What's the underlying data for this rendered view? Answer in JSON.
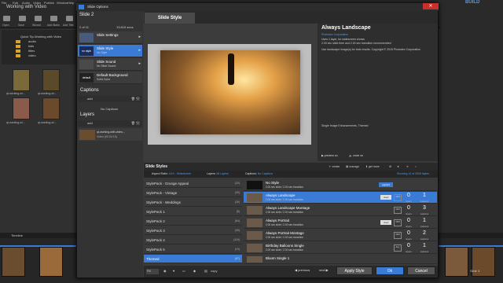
{
  "app": {
    "title": "Working with Video",
    "menu": [
      "File",
      "Edit",
      "Audio",
      "Video",
      "Publish",
      "Window",
      "Help"
    ],
    "toolbar": [
      "Open",
      "Save",
      "Wizard",
      "Add Blank",
      "Add Title"
    ],
    "build_label": "BUILD",
    "tree": [
      "Quick Tip-Working with Video",
      "audio",
      "kids",
      "titles",
      "video"
    ],
    "thumbs": [
      "qt-working-wi...",
      "qt-working-wi...",
      "qt-working-wi...",
      "qt-working-wi..."
    ],
    "timeline_tabs": [
      "Timeline"
    ],
    "slide3": {
      "title": "Slide 3",
      "sub": "Always Portrait"
    },
    "status": "1 Slide Selected"
  },
  "dialog": {
    "title": "Slide Options",
    "close": "✕",
    "slide": {
      "heading": "Slide 2",
      "nav": "2 of 11",
      "seconds": "13.815 secs"
    },
    "left_items": [
      {
        "icon": "",
        "title": "Slide Settings",
        "sub": "",
        "selected": false
      },
      {
        "icon": "no style",
        "title": "Slide Style",
        "sub": "No Style",
        "selected": true
      },
      {
        "icon": "",
        "title": "Slide Sound",
        "sub": "No Slide Sound",
        "selected": false
      },
      {
        "icon": "default",
        "title": "Default Background",
        "sub": "Solid Color",
        "selected": false
      }
    ],
    "captions": {
      "heading": "Captions",
      "add": "add",
      "empty": "No Captions"
    },
    "layers": {
      "heading": "Layers",
      "add": "add",
      "name": "qt-working-with-video...",
      "sub": "Video (00:00:15)"
    },
    "tab": "Slide Style",
    "info": {
      "title": "Always Landscape",
      "author": "Photodex Corporation",
      "line1": "Uses 1 layer, for widescreen shows",
      "line2": "2.00 sec slide time and 2.00 sec transition recommended",
      "line3": "Use landscape image(s) for best results. Copyright © 2015 Photodex Corporation",
      "tags": "Single Image Enhancements, Themed",
      "preview_on": "preview on",
      "mute_on": "mute on"
    },
    "styles": {
      "heading": "Slide Styles",
      "tools": [
        "create",
        "manage",
        "get more"
      ],
      "aspect_label": "Aspect Ratio:",
      "aspect_value": "16:9 - Widescreen",
      "layers_label": "Layers:",
      "layers_value": "All Layers",
      "captions_label": "Captions:",
      "captions_value": "No Captions",
      "showing": "Showing 12 of 2545 styles",
      "packs": [
        {
          "name": "StylePack - Grunge Appeal",
          "count": "(20)",
          "selected": false
        },
        {
          "name": "StylePack - Vintage",
          "count": "(30)",
          "selected": false
        },
        {
          "name": "StylePack - Weddings",
          "count": "(26)",
          "selected": false
        },
        {
          "name": "StylePack 1",
          "count": "(8)",
          "selected": false
        },
        {
          "name": "StylePack 2",
          "count": "(64)",
          "selected": false
        },
        {
          "name": "StylePack 3",
          "count": "(35)",
          "selected": false
        },
        {
          "name": "StylePack 4",
          "count": "(119)",
          "selected": false
        },
        {
          "name": "StylePack 5",
          "count": "(19)",
          "selected": false
        },
        {
          "name": "Themed",
          "count": "(97)",
          "selected": true
        }
      ],
      "rows": [
        {
          "name": "No Style",
          "sub": "2.00 sec slide / 2.00 sec transition",
          "badge": "applied",
          "ratio": "",
          "layers": "",
          "captions": "",
          "selected": false
        },
        {
          "name": "Always Landscape",
          "sub": "2.00 sec slide / 2.00 sec transition",
          "badge": "used",
          "ratio": "16:9",
          "layers": "0",
          "captions": "1",
          "selected": true
        },
        {
          "name": "Always Landscape Montage",
          "sub": "2.00 sec slide / 2.00 sec transition",
          "badge": "",
          "ratio": "16:9",
          "layers": "0",
          "captions": "3",
          "selected": false
        },
        {
          "name": "Always Portrait",
          "sub": "2.00 sec slide / 2.00 sec transition",
          "badge": "used",
          "ratio": "16:9",
          "layers": "0",
          "captions": "1",
          "selected": false
        },
        {
          "name": "Always Portrait Montage",
          "sub": "2.00 sec slide / 2.00 sec transition",
          "badge": "",
          "ratio": "16:9",
          "layers": "0",
          "captions": "2",
          "selected": false
        },
        {
          "name": "Birthday Balloons Single",
          "sub": "2.00 sec slide / 2.00 sec transition",
          "badge": "",
          "ratio": "Any",
          "layers": "0",
          "captions": "1",
          "selected": false
        },
        {
          "name": "Bloom Single 1",
          "sub": "2.00 sec slide / 2.00 sec transition",
          "badge": "",
          "ratio": "",
          "layers": "",
          "captions": "",
          "selected": false
        }
      ],
      "num_labels": {
        "layers": "layers",
        "captions": "captions",
        "aspect": "aspect"
      }
    },
    "bottom": {
      "search": "Fill",
      "copy": "copy",
      "previous": "previous",
      "next": "next",
      "apply": "Apply Style",
      "ok": "Ok",
      "cancel": "Cancel"
    }
  },
  "colors": {
    "accent": "#3a7bd5",
    "dialog_bg": "#3a3a3a"
  }
}
